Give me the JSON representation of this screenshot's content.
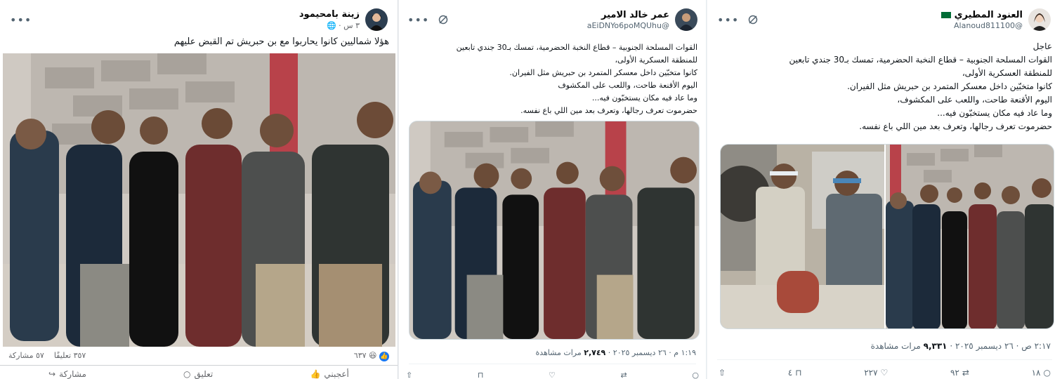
{
  "fb": {
    "name": "زينة بامحيمود",
    "time": "٣ س ·",
    "caption": "هؤلا شماليين كانوا يحاربوا مع بن حبريش تم القبض عليهم",
    "reaction_count": "٦٣٧",
    "comments": "٣٥٧ تعليقًا",
    "shares": "٥٧ مشاركة",
    "like_label": "أعجبني",
    "comment_label": "تعليق",
    "share_label": "مشاركة"
  },
  "tweet1": {
    "name": "عمر خالد الامير",
    "handle": "@aEiDNYo6poMQUhu",
    "lines": [
      "القوات المسلحة الجنوبية – قطاع النخبة الحضرمية، تمسك بـ30 جندي تابعين",
      "للمنطقة العسكرية الأولى،",
      "كانوا متخبّين داخل معسكر المتمرد بن حبريش مثل الفيران.",
      "اليوم الأقنعة طاحت، واللعب على المكشوف",
      "وما عاد فيه مكان يستخبّون فيه...",
      "حضرموت تعرف رجالها، وتعرف بعد مين اللي باع نفسه."
    ],
    "time": "١:١٩ م · ٢٦ ديسمبر ٢٠٢٥ ·",
    "views": "٢,٧٤٩",
    "views_label": "مرات مشاهدة"
  },
  "tweet2": {
    "name": "العنود المطيري",
    "handle": "@Alanoud811100",
    "lines": [
      "عاجل",
      "القوات المسلحة الجنوبية – قطاع النخبة الحضرمية، تمسك بـ30 جندي تابعين",
      "للمنطقة العسكرية الأولى،",
      "كانوا متخبّين داخل معسكر المتمرد بن حبريش مثل الفيران.",
      "اليوم الأقنعة طاحت، واللعب على المكشوف،",
      "وما عاد فيه مكان يستخبّون فيه...",
      "حضرموت تعرف رجالها، وتعرف بعد مين اللي باع نفسه."
    ],
    "time": "٢:١٧ ص · ٢٦ ديسمبر ٢٠٢٥ ·",
    "views": "٩,٣٣١",
    "views_label": "مرات مشاهدة",
    "replies": "١٨",
    "reposts": "٩٢",
    "likes": "٢٢٧",
    "bookmarks": "٤"
  },
  "colors": {
    "fb_blue": "#1877f2",
    "tw_text": "#0f1419",
    "tw_muted": "#536471",
    "flag_green": "#006c35"
  },
  "icons": [
    "more-dots-icon",
    "grok-icon",
    "globe-icon",
    "like-icon",
    "comment-icon",
    "share-icon",
    "reply-icon",
    "repost-icon",
    "heart-icon",
    "bookmark-icon",
    "upload-icon",
    "views-icon",
    "flag-icon"
  ]
}
